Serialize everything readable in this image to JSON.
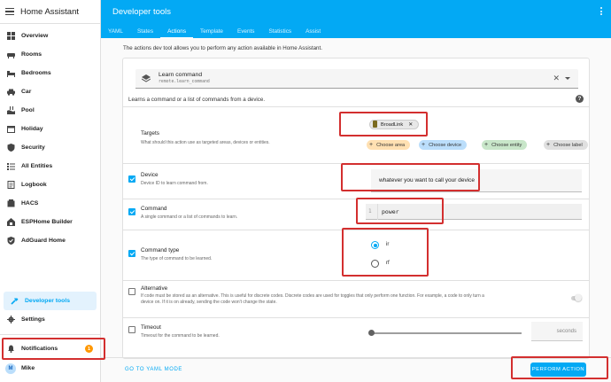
{
  "sidebar": {
    "title": "Home Assistant",
    "items": [
      {
        "label": "Overview",
        "icon": "grid-icon"
      },
      {
        "label": "Rooms",
        "icon": "sofa-icon"
      },
      {
        "label": "Bedrooms",
        "icon": "bed-icon"
      },
      {
        "label": "Car",
        "icon": "car-icon"
      },
      {
        "label": "Pool",
        "icon": "pool-icon"
      },
      {
        "label": "Holiday",
        "icon": "calendar-icon"
      },
      {
        "label": "Security",
        "icon": "shield-icon"
      },
      {
        "label": "All Entities",
        "icon": "list-icon"
      },
      {
        "label": "Logbook",
        "icon": "logbook-icon"
      },
      {
        "label": "HACS",
        "icon": "hacs-icon"
      },
      {
        "label": "ESPHome Builder",
        "icon": "chip-icon"
      },
      {
        "label": "AdGuard Home",
        "icon": "adguard-icon"
      }
    ],
    "developer_tools": "Developer tools",
    "settings": "Settings",
    "notifications": "Notifications",
    "notifications_count": "1",
    "user": "Mike",
    "user_initial": "M"
  },
  "header": {
    "title": "Developer tools",
    "tabs": [
      "YAML",
      "States",
      "Actions",
      "Template",
      "Events",
      "Statistics",
      "Assist"
    ],
    "active_tab": "Actions"
  },
  "main": {
    "intro": "The actions dev tool allows you to perform any action available in Home Assistant.",
    "action_name": "Learn command",
    "action_id": "remote.learn_command",
    "action_desc": "Learns a command or a list of commands from a device.",
    "targets": {
      "title": "Targets",
      "desc": "What should this action use as targeted areas, devices or entities.",
      "chip_label": "BroadLink",
      "choose_area": "Choose area",
      "choose_device": "Choose device",
      "choose_entity": "Choose entity",
      "choose_label": "Choose label"
    },
    "device": {
      "title": "Device",
      "desc": "Device ID to learn command from.",
      "value": "whatever you want to call your device"
    },
    "command": {
      "title": "Command",
      "desc": "A single command or a list of commands to learn.",
      "line_no": "1",
      "value": "power"
    },
    "command_type": {
      "title": "Command type",
      "desc": "The type of command to be learned.",
      "options": [
        "ir",
        "rf"
      ],
      "selected": "ir"
    },
    "alternative": {
      "title": "Alternative",
      "desc": "If code must be stored as an alternative. This is useful for discrete codes. Discrete codes are used for toggles that only perform one function. For example, a code to only turn a device on. If it is on already, sending the code won't change the state."
    },
    "timeout": {
      "title": "Timeout",
      "desc": "Timeout for the command to be learned.",
      "unit": "seconds"
    }
  },
  "footer": {
    "yaml_mode": "GO TO YAML MODE",
    "perform": "PERFORM ACTION"
  },
  "colors": {
    "accent": "#03a9f4",
    "highlight": "#d32f2f",
    "badge": "#ff9800"
  }
}
